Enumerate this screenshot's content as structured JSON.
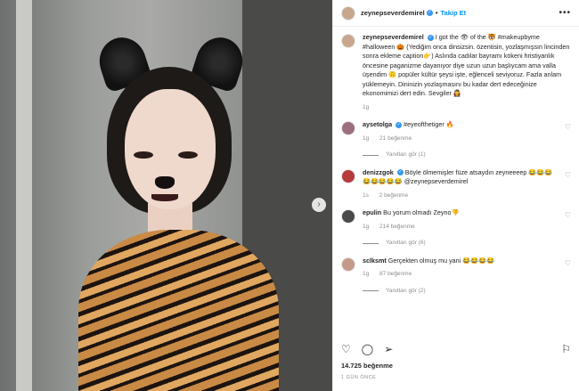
{
  "post": {
    "username": "zeynepseverdemirel",
    "follow_label": "Takip Et",
    "caption": "I got the 👁 of the 🐯 #makeupbyme #halloween 🎃 (Yediğim onca dinsizsin. özentisin, yozlaşmışsın lincinden sonra ekleme caption👉) Aslında cadılar bayramı kökeni hristiyanlık öncesine paganizme dayanıyor diye uzun uzun başlıycam ama valla üşendim 🙃 popüler kültür şeysi işte, eğlenceli seviyoruz. Fazla anlam yüklemeyin. Dininizin yozlaşmasını bu kadar dert edeceğinize ekonomimizi dert edin. Sevgiler 🧛‍♀️",
    "caption_time": "1g",
    "likes": "14.725 beğenme",
    "posted": "1 GÜN ÖNCE"
  },
  "comments": [
    {
      "user": "aysetolga",
      "verified": true,
      "text": "#eyeofthetiger 🔥",
      "time": "1g",
      "likes": "21 beğenme",
      "replies": "Yanıtları gör (1)"
    },
    {
      "user": "denizzgok",
      "verified": true,
      "text": "Böyle ölmemişler füze atsaydın zeyneeeep 😂😂😂😂😂😂😂😂 @zeynepseverdemirel",
      "time": "1s",
      "likes": "2 beğenme",
      "replies": ""
    },
    {
      "user": "epulin",
      "verified": false,
      "text": "Bu yorum olmadı Zeyno👎",
      "time": "1g",
      "likes": "214 beğenme",
      "replies": "Yanıtları gör (6)"
    },
    {
      "user": "sclksmt",
      "verified": false,
      "text": "Gerçekten olmuş mu yani 😂😂😂😂",
      "time": "1g",
      "likes": "87 beğenme",
      "replies": "Yanıtları gör (2)"
    }
  ],
  "icons": {
    "heart": "♡",
    "comment": "◯",
    "share": "➢",
    "save": "⚐",
    "more": "•••",
    "next": "›"
  }
}
